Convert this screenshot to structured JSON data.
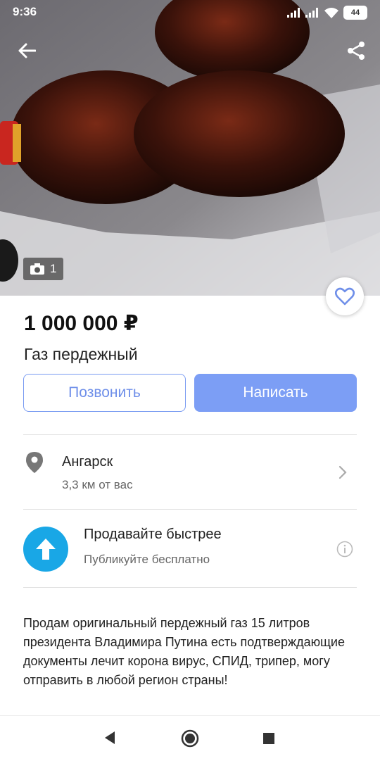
{
  "status_bar": {
    "time": "9:36",
    "battery": "44"
  },
  "listing": {
    "photo_count": "1",
    "price": "1 000 000 ₽",
    "title": "Газ пердежный",
    "description": "Продам оригинальный пердежный газ 15 литров президента Владимира Путина есть подтверждающие документы лечит корона вирус, СПИД, трипер, могу отправить в любой регион страны!"
  },
  "actions": {
    "call_label": "Позвонить",
    "write_label": "Написать"
  },
  "location": {
    "city": "Ангарск",
    "distance": "3,3 км от вас"
  },
  "promo": {
    "title": "Продавайте быстрее",
    "subtitle": "Публикуйте бесплатно"
  },
  "colors": {
    "accent": "#7c9ef5",
    "promo": "#19a7e6",
    "favorite": "#6f8fe9"
  }
}
